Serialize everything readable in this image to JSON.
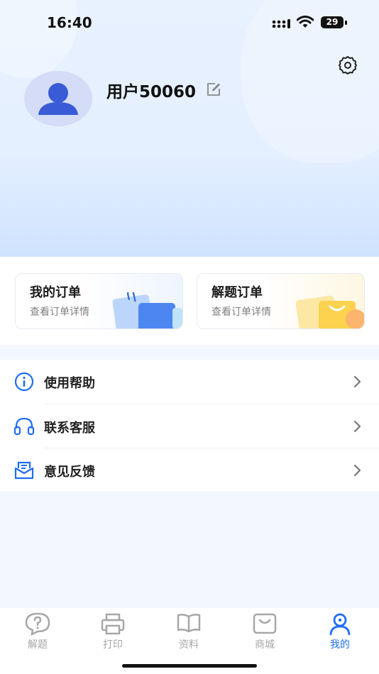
{
  "status_bar": {
    "time": "16:40",
    "battery": "29"
  },
  "profile": {
    "username": "用户50060"
  },
  "orders": [
    {
      "title": "我的订单",
      "subtitle": "查看订单详情"
    },
    {
      "title": "解题订单",
      "subtitle": "查看订单详情"
    }
  ],
  "menu": [
    {
      "label": "使用帮助",
      "icon": "info-icon"
    },
    {
      "label": "联系客服",
      "icon": "headset-icon"
    },
    {
      "label": "意见反馈",
      "icon": "feedback-mail-icon"
    }
  ],
  "tabs": [
    {
      "label": "解题",
      "icon": "question-bubble-icon"
    },
    {
      "label": "打印",
      "icon": "printer-icon"
    },
    {
      "label": "资料",
      "icon": "book-icon"
    },
    {
      "label": "商城",
      "icon": "shopping-bag-icon"
    },
    {
      "label": "我的",
      "icon": "user-icon",
      "active": true
    }
  ],
  "colors": {
    "accent": "#1f6df2",
    "inactive": "#a7a7a7",
    "avatar_bg": "#d4dcf7",
    "avatar_fg": "#3a5bd6"
  }
}
